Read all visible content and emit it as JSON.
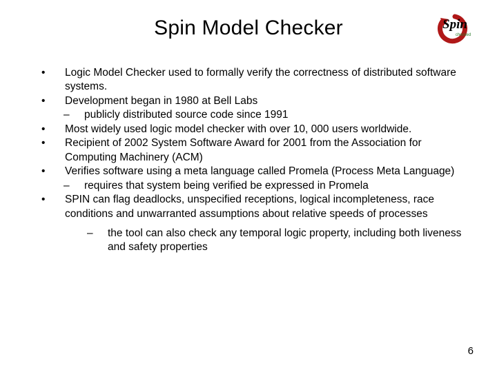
{
  "title": "Spin Model Checker",
  "logo": {
    "word": "Spin",
    "tag": "checked"
  },
  "bullets": [
    {
      "text": "Logic Model Checker used to formally verify the correctness of distributed software systems."
    },
    {
      "text": "Development began in 1980 at Bell Labs",
      "subs": [
        "publicly distributed source code since 1991"
      ]
    },
    {
      "text": "Most widely used logic model checker with over 10, 000 users worldwide."
    },
    {
      "text": "Recipient of 2002 System Software Award for 2001 from the Association for Computing Machinery (ACM)"
    },
    {
      "text": "Verifies software using a meta language called Promela (Process Meta Language)",
      "subs": [
        "requires that system being verified be expressed in Promela"
      ]
    },
    {
      "text": "SPIN can flag deadlocks, unspecified receptions, logical incompleteness, race conditions and unwarranted assumptions about relative speeds of processes"
    }
  ],
  "trailing_sub": "the tool can also check any temporal logic property, including both liveness and safety properties",
  "marks": {
    "bullet": "•",
    "dash": "–"
  },
  "page_number": "6"
}
